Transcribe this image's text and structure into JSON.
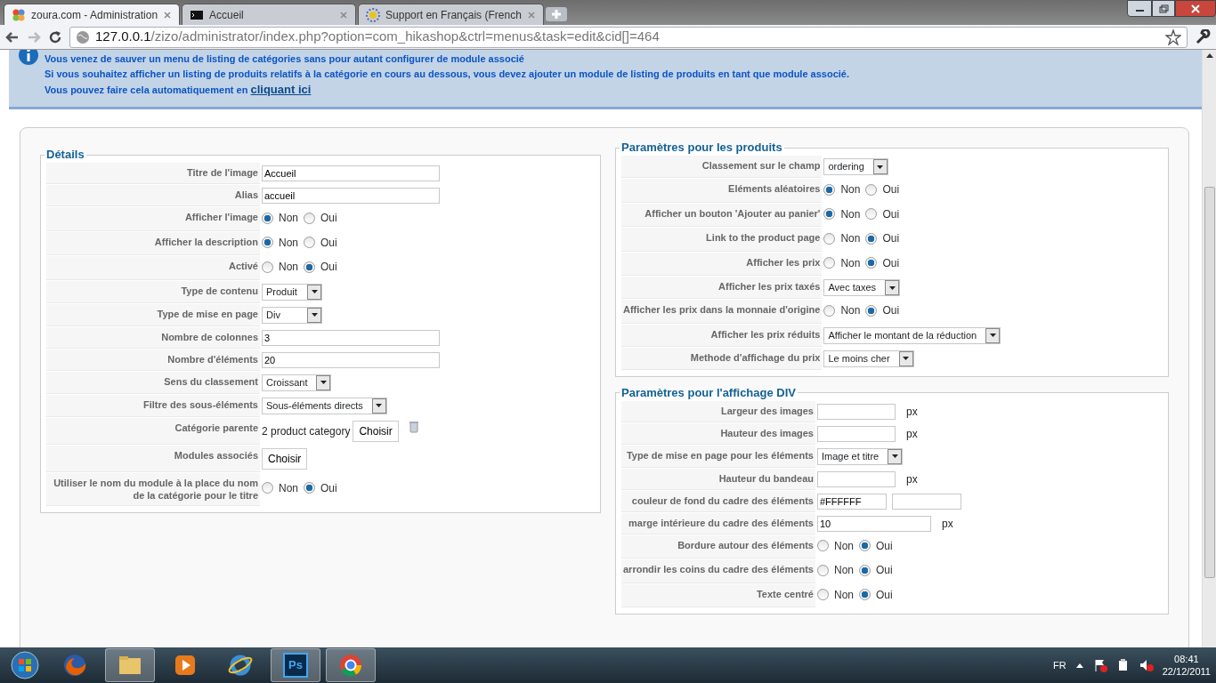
{
  "browser": {
    "tabs": [
      {
        "title": "zoura.com - Administration",
        "kind": "joomla",
        "selected": true
      },
      {
        "title": "Accueil",
        "kind": "terminal",
        "selected": false
      },
      {
        "title": "Support en Français (French",
        "kind": "sun",
        "selected": false
      }
    ],
    "url": {
      "host": "127.0.0.1",
      "path": "/zizo/administrator/index.php?option=com_hikashop&ctrl=menus&task=edit&cid[]=464"
    }
  },
  "message": {
    "lines": [
      "Vous venez de sauver un menu de listing de catégories sans pour autant configurer de module associé",
      "Si vous souhaitez afficher un listing de produits relatifs à la catégorie en cours au dessous, vous devez ajouter un module de listing de produits en tant que module associé.",
      "Vous pouvez faire cela automatiquement en"
    ],
    "link": "cliquant ici"
  },
  "panels": [
    {
      "title": "Détails",
      "rows": [
        {
          "label": "Titre de l'image",
          "kind": "text",
          "value": "Accueil"
        },
        {
          "label": "Alias",
          "kind": "text",
          "value": "accueil"
        },
        {
          "label": "Afficher l'image",
          "kind": "radio",
          "options": [
            {
              "label": "Non",
              "selected": true
            },
            {
              "label": "Oui",
              "selected": false
            }
          ]
        },
        {
          "label": "Afficher la description",
          "kind": "radio",
          "options": [
            {
              "label": "Non",
              "selected": true
            },
            {
              "label": "Oui",
              "selected": false
            }
          ]
        },
        {
          "label": "Activé",
          "kind": "radio",
          "options": [
            {
              "label": "Non",
              "selected": false
            },
            {
              "label": "Oui",
              "selected": true
            }
          ]
        },
        {
          "label": "Type de contenu",
          "kind": "select",
          "value": "Produit"
        },
        {
          "label": "Type de mise en page",
          "kind": "select",
          "value": "Div"
        },
        {
          "label": "Nombre de colonnes",
          "kind": "text",
          "value": "3"
        },
        {
          "label": "Nombre d'éléments",
          "kind": "text",
          "value": "20"
        },
        {
          "label": "Sens du classement",
          "kind": "select",
          "value": "Croissant"
        },
        {
          "label": "Filtre des sous-éléments",
          "kind": "select",
          "value": "Sous-éléments directs"
        },
        {
          "label": "Catégorie parente",
          "kind": "chooser",
          "value": "2 product category",
          "button": "Choisir"
        },
        {
          "label": "Modules associés",
          "kind": "button",
          "button": "Choisir"
        },
        {
          "label": "Utiliser le nom du module à la place du nom de la catégorie pour le titre",
          "kind": "radio",
          "options": [
            {
              "label": "Non",
              "selected": false
            },
            {
              "label": "Oui",
              "selected": true
            }
          ]
        }
      ]
    },
    {
      "title": "Paramètres pour les produits",
      "rows": [
        {
          "label": "Classement sur le champ",
          "kind": "select",
          "value": "ordering"
        },
        {
          "label": "Eléments aléatoires",
          "kind": "radio",
          "options": [
            {
              "label": "Non",
              "selected": true
            },
            {
              "label": "Oui",
              "selected": false
            }
          ]
        },
        {
          "label": "Afficher un bouton 'Ajouter au panier'",
          "kind": "radio",
          "options": [
            {
              "label": "Non",
              "selected": true
            },
            {
              "label": "Oui",
              "selected": false
            }
          ]
        },
        {
          "label": "Link to the product page",
          "kind": "radio",
          "options": [
            {
              "label": "Non",
              "selected": false
            },
            {
              "label": "Oui",
              "selected": true
            }
          ]
        },
        {
          "label": "Afficher les prix",
          "kind": "radio",
          "options": [
            {
              "label": "Non",
              "selected": false
            },
            {
              "label": "Oui",
              "selected": true
            }
          ]
        },
        {
          "label": "Afficher les prix taxés",
          "kind": "select",
          "value": "Avec taxes"
        },
        {
          "label": "Afficher les prix dans la monnaie d'origine",
          "kind": "radio",
          "options": [
            {
              "label": "Non",
              "selected": false
            },
            {
              "label": "Oui",
              "selected": true
            }
          ]
        },
        {
          "label": "Afficher les prix réduits",
          "kind": "select",
          "value": "Afficher le montant de la réduction"
        },
        {
          "label": "Methode d'affichage du prix",
          "kind": "select",
          "value": "Le moins cher"
        }
      ]
    },
    {
      "title": "Paramètres pour l'affichage DIV",
      "rows": [
        {
          "label": "Largeur des images",
          "kind": "text_unit",
          "value": "",
          "unit": "px"
        },
        {
          "label": "Hauteur des images",
          "kind": "text_unit",
          "value": "",
          "unit": "px"
        },
        {
          "label": "Type de mise en page pour les éléments",
          "kind": "select",
          "value": "Image et titre"
        },
        {
          "label": "Hauteur du bandeau",
          "kind": "text_unit",
          "value": "",
          "unit": "px"
        },
        {
          "label": "couleur de fond du cadre des éléments",
          "kind": "color",
          "value": "#FFFFFF"
        },
        {
          "label": "marge intérieure du cadre des éléments",
          "kind": "text_unit",
          "value": "10",
          "unit": "px"
        },
        {
          "label": "Bordure autour des éléments",
          "kind": "radio",
          "options": [
            {
              "label": "Non",
              "selected": false
            },
            {
              "label": "Oui",
              "selected": true
            }
          ]
        },
        {
          "label": "arrondir les coins du cadre des éléments",
          "kind": "radio",
          "options": [
            {
              "label": "Non",
              "selected": false
            },
            {
              "label": "Oui",
              "selected": true
            }
          ]
        },
        {
          "label": "Texte centré",
          "kind": "radio",
          "options": [
            {
              "label": "Non",
              "selected": false
            },
            {
              "label": "Oui",
              "selected": true
            }
          ]
        }
      ]
    }
  ],
  "taskbar": {
    "apps": [
      {
        "kind": "firefox",
        "running": false
      },
      {
        "kind": "folder",
        "running": true
      },
      {
        "kind": "media",
        "running": false
      },
      {
        "kind": "ie",
        "running": false
      },
      {
        "kind": "photoshop",
        "label": "Ps",
        "running": true
      },
      {
        "kind": "chrome",
        "running": true
      }
    ],
    "language": "FR",
    "time": "08:41",
    "date": "22/12/2011"
  }
}
